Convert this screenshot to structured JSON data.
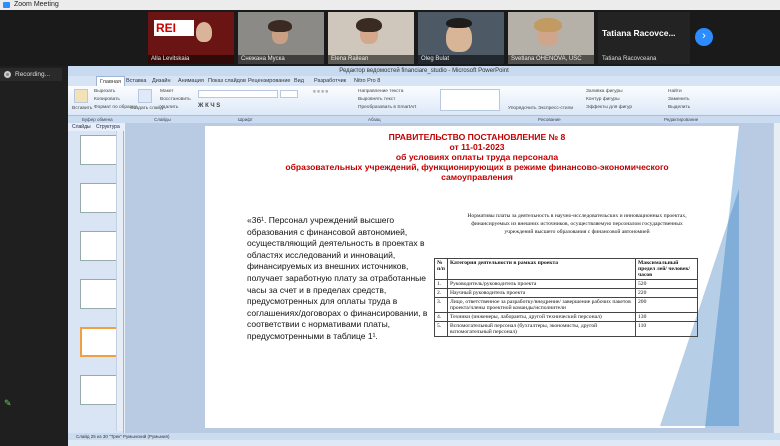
{
  "window": {
    "title": "Zoom Meeting"
  },
  "recording": {
    "label": "Recording..."
  },
  "participants": [
    {
      "name": "Alla Levitskaia"
    },
    {
      "name": "Снежана Муска"
    },
    {
      "name": "Elena Railean"
    },
    {
      "name": "Oleg Bulat"
    },
    {
      "name": "Svetlana OHENOVA, USC"
    }
  ],
  "featured": {
    "name": "Tatiana Racovce...",
    "subname": "Tatiana Racovceana"
  },
  "ppt": {
    "title": "Редактор ведомостей financiare_studio - Microsoft PowerPoint",
    "tabs": [
      "Главная",
      "Вставка",
      "Дизайн",
      "Анимация",
      "Показ слайдов",
      "Рецензирование",
      "Вид",
      "Разработчик",
      "Nitro Pro 8"
    ],
    "ribbon": {
      "paste": "Вставить",
      "create_slide": "Создать слайд",
      "layout": "Макет",
      "reset": "Восстановить",
      "delete": "Удалить",
      "cut": "Вырезать",
      "copy": "Копировать",
      "format": "Формат по образцу",
      "arrange": "Упорядочить",
      "quick_styles": "Экспресс-стили",
      "find": "Найти",
      "replace": "Заменить",
      "select": "Выделить",
      "shape_fill": "Заливка фигуры",
      "shape_outline": "Контур фигуры",
      "shape_effects": "Эффекты для фигур",
      "text_direction": "Направление текста",
      "align_text": "Выровнять текст",
      "smartart": "Преобразовать в SmartArt"
    },
    "groups": [
      "Буфер обмена",
      "Слайды",
      "Шрифт",
      "Абзац",
      "Рисование",
      "Редактирование"
    ],
    "panel_tabs": [
      "Слайды",
      "Структура"
    ],
    "status": "Слайд 25 из 30   \"Трек\"   Румынский (Румыния)"
  },
  "slide": {
    "title_lines": [
      "ПРАВИТЕЛЬСТВО ПОСТАНОВЛЕНИЕ № 8",
      "от 11-01-2023",
      "об условиях оплаты труда персонала",
      "образовательных учреждений, функционирующих в режиме финансово-экономического",
      "самоуправления"
    ],
    "quote": "«36¹. Персонал учреждений высшего образования с финансовой автономией, осуществляющий деятельность в проектах в областях исследований и инноваций, финансируемых из внешних источников, получает заработную плату за отработанные часы за счет и в пределах средств, предусмотренных для оплаты труда в соглашениях/договорах о финансировании, в соответствии с нормативами платы, предусмотренными в таблице 1¹.",
    "table_caption": "Нормативы платы за деятельность в научно-исследовательских и инновационных проектах, финансируемых из внешних источников, осуществляемую персоналом государственных учреждений высшего образования с финансовой автономией",
    "table": {
      "headers": [
        "№ п/п",
        "Категория деятельности в рамках проекта",
        "Максимальный предел лей/ человек/часов"
      ],
      "rows": [
        [
          "1.",
          "Руководитель/руководитель проекта",
          "520"
        ],
        [
          "2.",
          "Научный руководитель проекта",
          "220"
        ],
        [
          "3.",
          "Лицо, ответственное за разработку/внедрение/ завершение рабочих пакетов проекта/члены проектной команды/исполнители",
          "200"
        ],
        [
          "4.",
          "Техники (инженеры, лаборанты, другой технический персонал)",
          "130"
        ],
        [
          "5.",
          "Вспомогательный персонал (бухгалтеры, экономисты, другой вспомогательный персонал)",
          "110"
        ]
      ]
    }
  },
  "colors": {
    "title_red": "#c00000",
    "zoom_blue": "#2d8cff"
  }
}
